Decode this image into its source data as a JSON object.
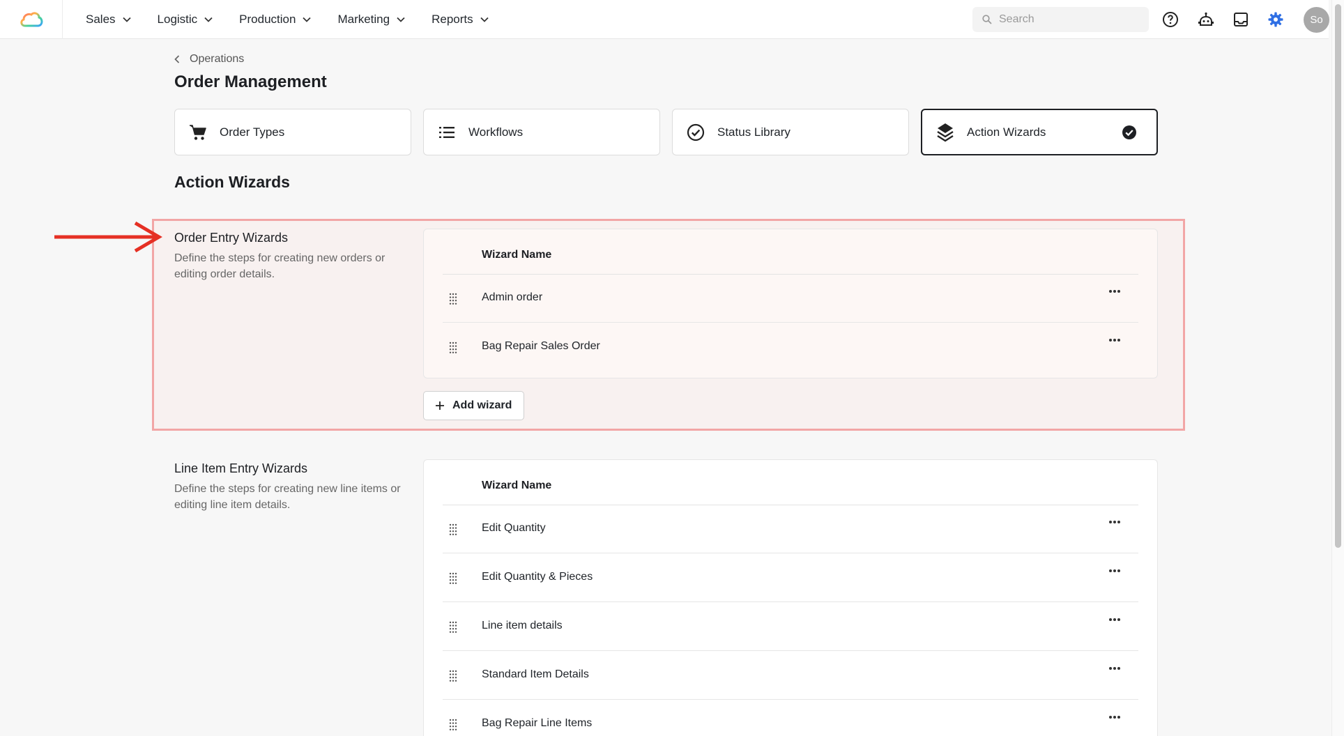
{
  "nav": {
    "items": [
      {
        "label": "Sales"
      },
      {
        "label": "Logistic"
      },
      {
        "label": "Production"
      },
      {
        "label": "Marketing"
      },
      {
        "label": "Reports"
      }
    ]
  },
  "search": {
    "placeholder": "Search"
  },
  "user": {
    "initials": "So"
  },
  "accent_color": "#2f6fe4",
  "breadcrumb": {
    "parent": "Operations"
  },
  "page": {
    "title": "Order Management",
    "section_title": "Action Wizards"
  },
  "tabs": [
    {
      "label": "Order Types",
      "icon": "cart-icon"
    },
    {
      "label": "Workflows",
      "icon": "list-icon"
    },
    {
      "label": "Status Library",
      "icon": "check-circle-icon"
    },
    {
      "label": "Action Wizards",
      "icon": "layers-icon",
      "active": true
    }
  ],
  "groups": [
    {
      "title": "Order Entry Wizards",
      "description": "Define the steps for creating new orders or editing order details.",
      "column_header": "Wizard Name",
      "rows": [
        "Admin order",
        "Bag Repair Sales Order"
      ],
      "add_label": "Add wizard"
    },
    {
      "title": "Line Item Entry Wizards",
      "description": "Define the steps for creating new line items or editing line item details.",
      "column_header": "Wizard Name",
      "rows": [
        "Edit Quantity",
        "Edit Quantity & Pieces",
        "Line item details",
        "Standard Item Details",
        "Bag Repair Line Items"
      ]
    }
  ]
}
